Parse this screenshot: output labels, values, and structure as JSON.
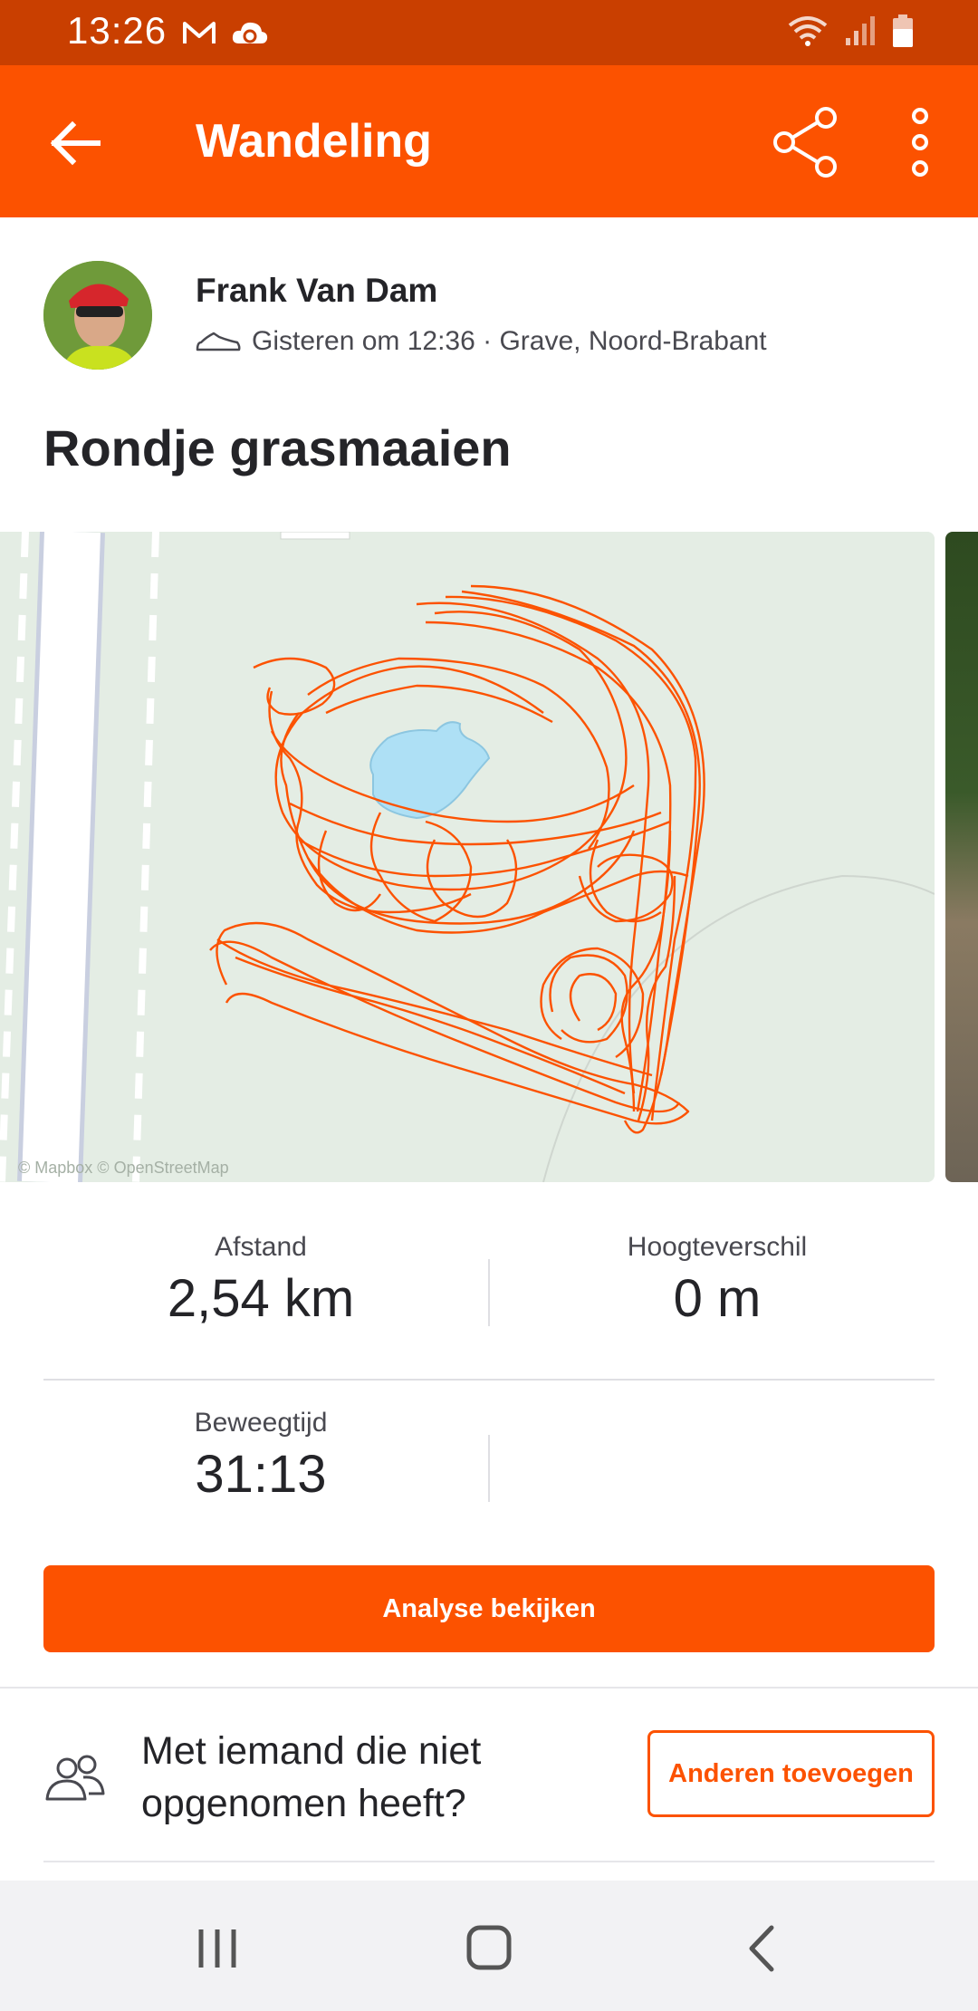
{
  "status_bar": {
    "time": "13:26",
    "left_icons": [
      "gmail-icon",
      "cloud-sync-icon"
    ],
    "right_icons": [
      "wifi-icon",
      "signal-icon",
      "battery-icon"
    ]
  },
  "app_bar": {
    "title": "Wandeling",
    "back_icon": "arrow-left-icon",
    "share_icon": "share-icon",
    "more_icon": "more-vertical-icon"
  },
  "athlete": {
    "name": "Frank Van Dam",
    "meta": "Gisteren om 12:36 · Grave, Noord-Brabant",
    "activity_icon": "shoe-icon"
  },
  "activity": {
    "title": "Rondje grasmaaien"
  },
  "map": {
    "attribution": "© Mapbox © OpenStreetMap",
    "route_color": "#fc5200",
    "water_color": "#aee0f5",
    "land_color": "#e4ede4"
  },
  "stats": {
    "distance_label": "Afstand",
    "distance_value": "2,54 km",
    "elevation_label": "Hoogteverschil",
    "elevation_value": "0 m",
    "moving_time_label": "Beweegtijd",
    "moving_time_value": "31:13"
  },
  "analysis_button": "Analyse bekijken",
  "invite": {
    "text": "Met iemand die niet opgenomen heeft?",
    "button": "Anderen toevoegen",
    "icon": "people-icon"
  },
  "nav_bar": {
    "icons": [
      "recent-apps-icon",
      "home-icon",
      "back-nav-icon"
    ]
  },
  "colors": {
    "brand": "#fc5200",
    "status_bar": "#c93f00"
  }
}
